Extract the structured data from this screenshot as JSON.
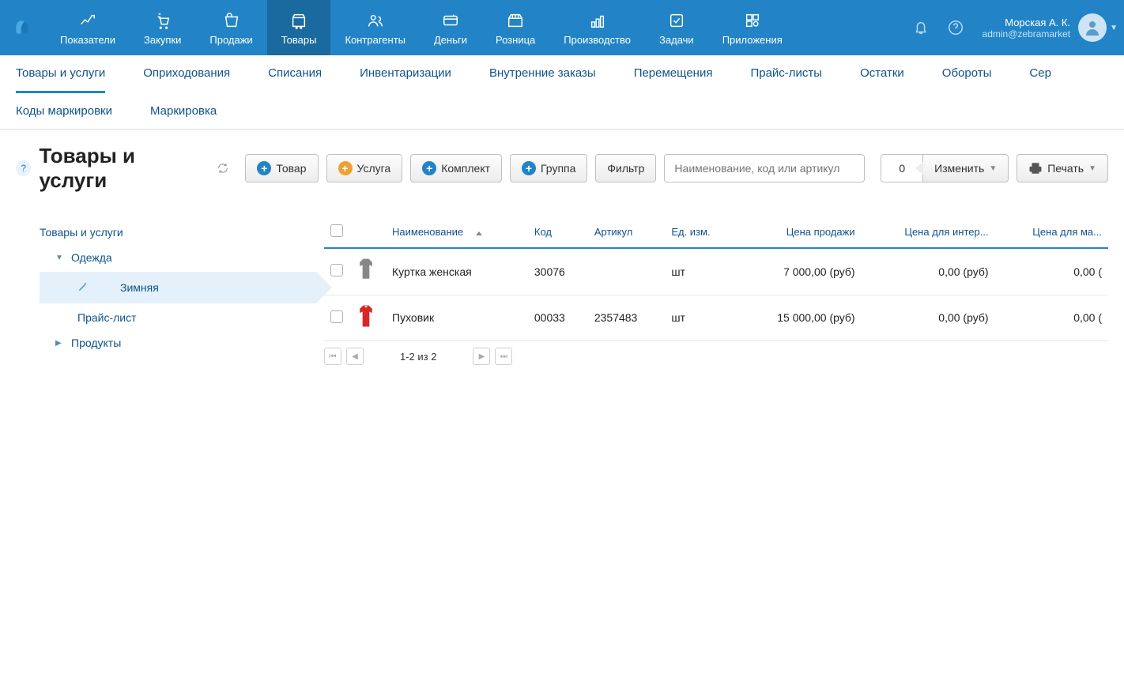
{
  "topnav": {
    "items": [
      {
        "label": "Показатели"
      },
      {
        "label": "Закупки"
      },
      {
        "label": "Продажи"
      },
      {
        "label": "Товары",
        "active": true
      },
      {
        "label": "Контрагенты"
      },
      {
        "label": "Деньги"
      },
      {
        "label": "Розница"
      },
      {
        "label": "Производство"
      },
      {
        "label": "Задачи"
      },
      {
        "label": "Приложения"
      }
    ],
    "user_name": "Морская А. К.",
    "user_email": "admin@zebramarket"
  },
  "subnav": {
    "row1": [
      {
        "label": "Товары и услуги",
        "active": true
      },
      {
        "label": "Оприходования"
      },
      {
        "label": "Списания"
      },
      {
        "label": "Инвентаризации"
      },
      {
        "label": "Внутренние заказы"
      },
      {
        "label": "Перемещения"
      },
      {
        "label": "Прайс-листы"
      },
      {
        "label": "Остатки"
      },
      {
        "label": "Обороты"
      },
      {
        "label": "Сер"
      }
    ],
    "row2": [
      {
        "label": "Коды маркировки"
      },
      {
        "label": "Маркировка"
      }
    ]
  },
  "toolbar": {
    "title": "Товары и услуги",
    "btn_product": "Товар",
    "btn_service": "Услуга",
    "btn_kit": "Комплект",
    "btn_group": "Группа",
    "btn_filter": "Фильтр",
    "search_placeholder": "Наименование, код или артикул",
    "count": "0",
    "change_label": "Изменить",
    "print_label": "Печать"
  },
  "tree": {
    "root": "Товары и услуги",
    "clothes": "Одежда",
    "winter": "Зимняя",
    "pricelist": "Прайс-лист",
    "products": "Продукты"
  },
  "table": {
    "headers": {
      "name": "Наименование",
      "code": "Код",
      "sku": "Артикул",
      "unit": "Ед. изм.",
      "price": "Цена продажи",
      "price_web": "Цена для интер...",
      "price_small": "Цена для ма..."
    },
    "rows": [
      {
        "name": "Куртка женская",
        "code": "30076",
        "sku": "",
        "unit": "шт",
        "price": "7 000,00 (руб)",
        "price_web": "0,00 (руб)",
        "price_small": "0,00 ("
      },
      {
        "name": "Пуховик",
        "code": "00033",
        "sku": "2357483",
        "unit": "шт",
        "price": "15 000,00 (руб)",
        "price_web": "0,00 (руб)",
        "price_small": "0,00 ("
      }
    ],
    "pager": "1-2 из 2"
  }
}
